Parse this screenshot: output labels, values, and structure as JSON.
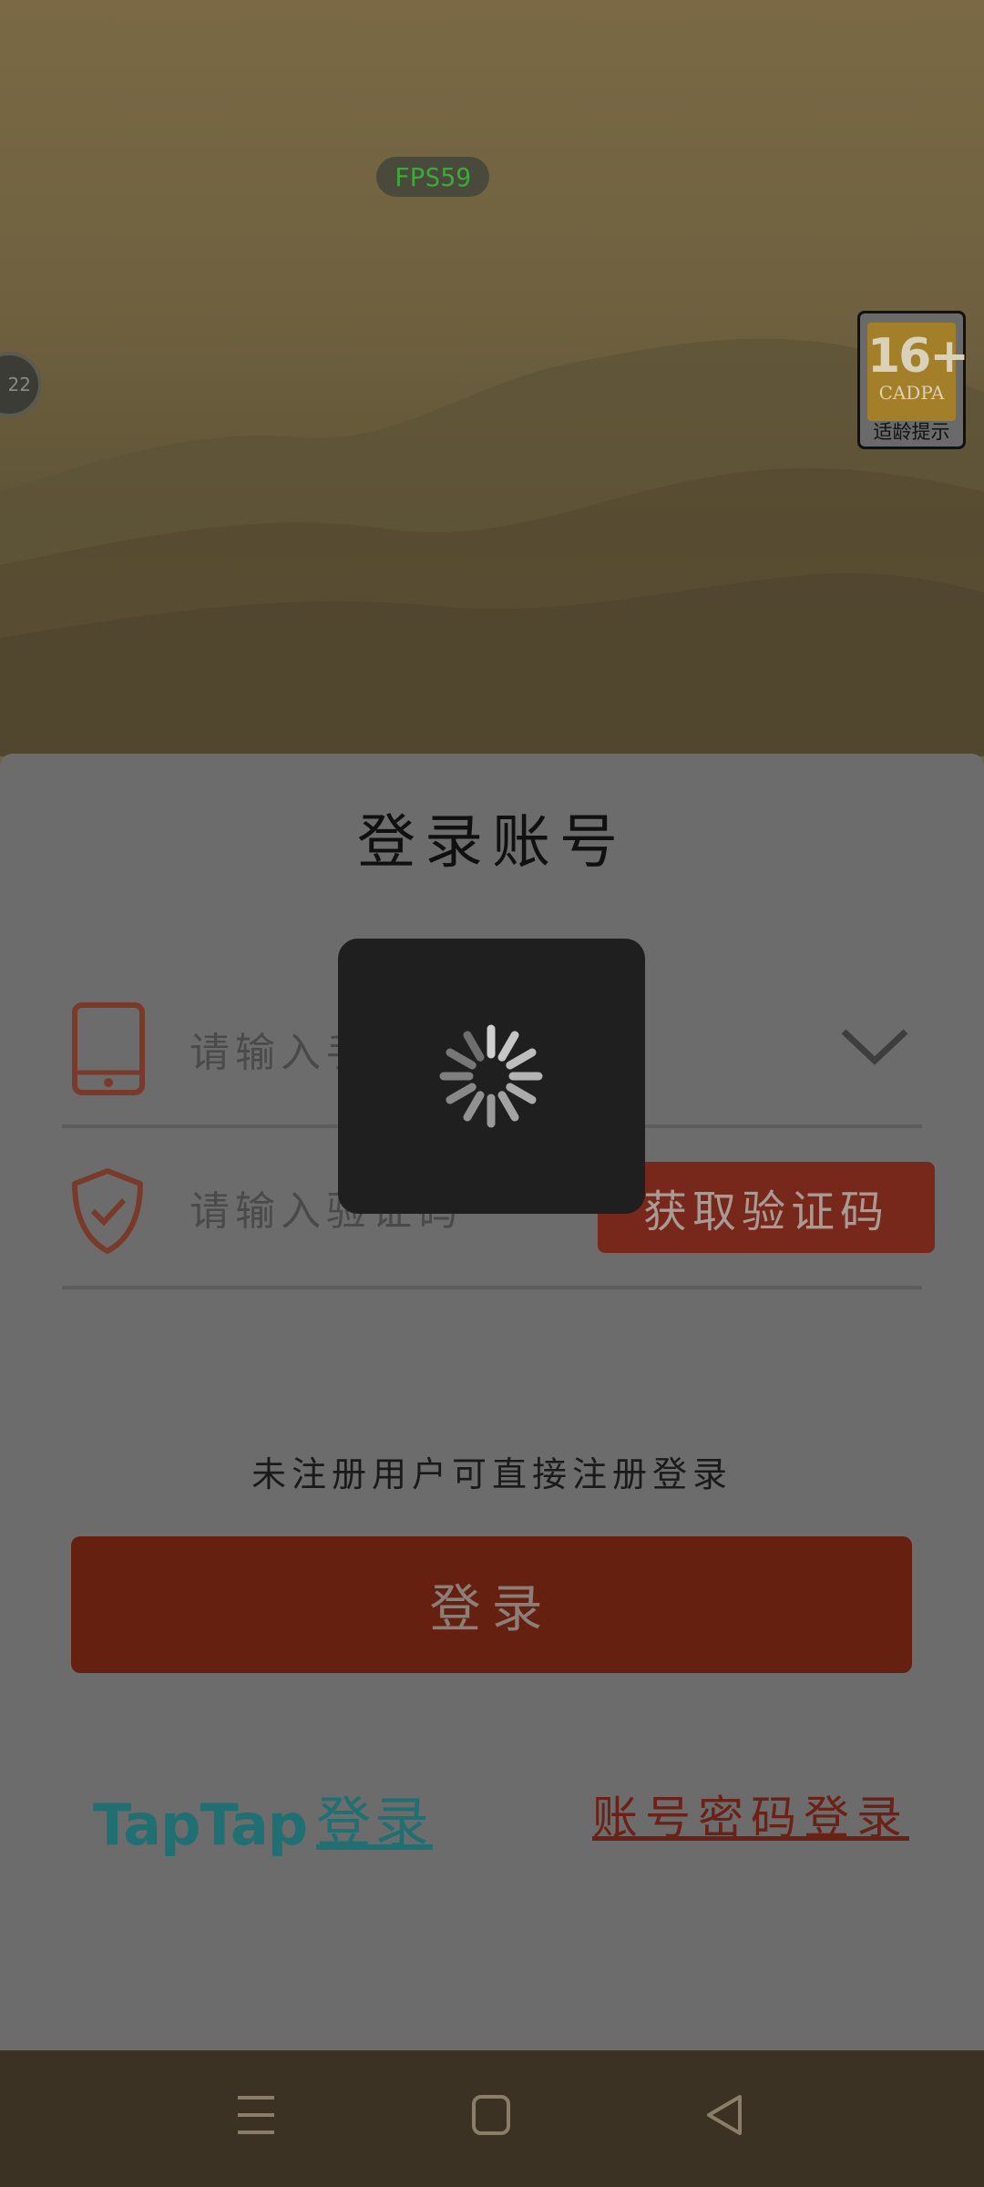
{
  "overlay": {
    "fps_label": "FPS59",
    "side_badge_text": "22"
  },
  "age_rating": {
    "number": "16+",
    "org": "CADPA",
    "tip": "适龄提示"
  },
  "login_sheet": {
    "title": "登录账号",
    "phone_placeholder": "请输入手机号",
    "code_placeholder": "请输入验证码",
    "get_code_label": "获取验证码",
    "hint": "未注册用户可直接注册登录",
    "login_label": "登录",
    "taptap_brand": "TapTap",
    "taptap_label": "登录",
    "password_login_label": "账号密码登录"
  },
  "colors": {
    "accent_red": "#66200f",
    "teal": "#1f6f73",
    "sheet_bg": "#6c6c6c"
  },
  "icons": {
    "phone": "tablet-phone-icon",
    "verify": "shield-check-icon",
    "dropdown": "chevron-down-icon",
    "spinner": "loading-spinner-icon",
    "nav_recents": "menu-lines-icon",
    "nav_home": "square-home-icon",
    "nav_back": "triangle-back-icon"
  }
}
